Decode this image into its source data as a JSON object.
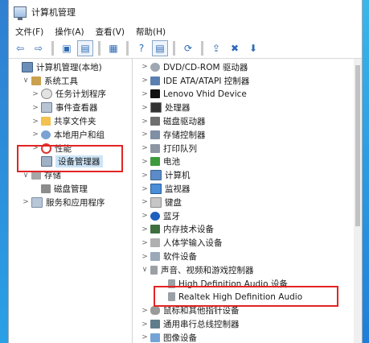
{
  "window": {
    "title": "计算机管理"
  },
  "menu": [
    {
      "label": "文件(F)"
    },
    {
      "label": "操作(A)"
    },
    {
      "label": "查看(V)"
    },
    {
      "label": "帮助(H)"
    }
  ],
  "toolbar": [
    {
      "name": "back-button",
      "glyph": "⇦"
    },
    {
      "name": "forward-button",
      "glyph": "⇨"
    },
    {
      "name": "sep"
    },
    {
      "name": "up-folder-button",
      "glyph": "▣"
    },
    {
      "name": "show-hide-tree-button",
      "glyph": "▤"
    },
    {
      "name": "sep"
    },
    {
      "name": "properties-button",
      "glyph": "▦"
    },
    {
      "name": "sep"
    },
    {
      "name": "help-button",
      "glyph": "?"
    },
    {
      "name": "view-button",
      "glyph": "▤"
    },
    {
      "name": "sep"
    },
    {
      "name": "scan-hardware-button",
      "glyph": "⟳"
    },
    {
      "name": "sep"
    },
    {
      "name": "update-driver-button",
      "glyph": "⇪"
    },
    {
      "name": "uninstall-button",
      "glyph": "✖"
    },
    {
      "name": "enable-device-button",
      "glyph": "⬇"
    }
  ],
  "left_tree": [
    {
      "label": "计算机管理(本地)",
      "level": 0,
      "expander": "",
      "icon": "comp"
    },
    {
      "label": "系统工具",
      "level": 1,
      "expander": "∨",
      "icon": "tools"
    },
    {
      "label": "任务计划程序",
      "level": 2,
      "expander": ">",
      "icon": "task"
    },
    {
      "label": "事件查看器",
      "level": 2,
      "expander": ">",
      "icon": "event"
    },
    {
      "label": "共享文件夹",
      "level": 2,
      "expander": ">",
      "icon": "folder"
    },
    {
      "label": "本地用户和组",
      "level": 2,
      "expander": ">",
      "icon": "users"
    },
    {
      "label": "性能",
      "level": 2,
      "expander": ">",
      "icon": "perf"
    },
    {
      "label": "设备管理器",
      "level": 2,
      "expander": "",
      "icon": "devmgr",
      "selected": true
    },
    {
      "label": "存储",
      "level": 1,
      "expander": "∨",
      "icon": "storage"
    },
    {
      "label": "磁盘管理",
      "level": 2,
      "expander": "",
      "icon": "disk"
    },
    {
      "label": "服务和应用程序",
      "level": 1,
      "expander": ">",
      "icon": "svc"
    }
  ],
  "right_tree": [
    {
      "label": "DVD/CD-ROM 驱动器",
      "expander": ">",
      "icon": "dvd",
      "level": 0
    },
    {
      "label": "IDE ATA/ATAPI 控制器",
      "expander": ">",
      "icon": "ide",
      "level": 0
    },
    {
      "label": "Lenovo Vhid Device",
      "expander": ">",
      "icon": "cam",
      "level": 0
    },
    {
      "label": "处理器",
      "expander": ">",
      "icon": "cpu",
      "level": 0
    },
    {
      "label": "磁盘驱动器",
      "expander": ">",
      "icon": "hdd",
      "level": 0
    },
    {
      "label": "存储控制器",
      "expander": ">",
      "icon": "ctrl",
      "level": 0
    },
    {
      "label": "打印队列",
      "expander": ">",
      "icon": "printq",
      "level": 0
    },
    {
      "label": "电池",
      "expander": ">",
      "icon": "battery",
      "level": 0
    },
    {
      "label": "计算机",
      "expander": ">",
      "icon": "pc",
      "level": 0
    },
    {
      "label": "监视器",
      "expander": ">",
      "icon": "monitor",
      "level": 0
    },
    {
      "label": "键盘",
      "expander": ">",
      "icon": "kbd",
      "level": 0
    },
    {
      "label": "蓝牙",
      "expander": ">",
      "icon": "bt",
      "level": 0
    },
    {
      "label": "内存技术设备",
      "expander": ">",
      "icon": "mem",
      "level": 0
    },
    {
      "label": "人体学输入设备",
      "expander": ">",
      "icon": "hid",
      "level": 0
    },
    {
      "label": "软件设备",
      "expander": ">",
      "icon": "sw",
      "level": 0
    },
    {
      "label": "声音、视频和游戏控制器",
      "expander": "∨",
      "icon": "sound",
      "level": 0
    },
    {
      "label": "High Definition Audio 设备",
      "expander": "",
      "icon": "sound",
      "level": 1
    },
    {
      "label": "Realtek High Definition Audio",
      "expander": "",
      "icon": "sound",
      "level": 1
    },
    {
      "label": "鼠标和其他指针设备",
      "expander": ">",
      "icon": "mouse",
      "level": 0
    },
    {
      "label": "通用串行总线控制器",
      "expander": ">",
      "icon": "usb",
      "level": 0
    },
    {
      "label": "图像设备",
      "expander": ">",
      "icon": "img",
      "level": 0
    }
  ],
  "colors": {
    "highlight_box": "#e22424",
    "selection": "#cce4f7"
  }
}
